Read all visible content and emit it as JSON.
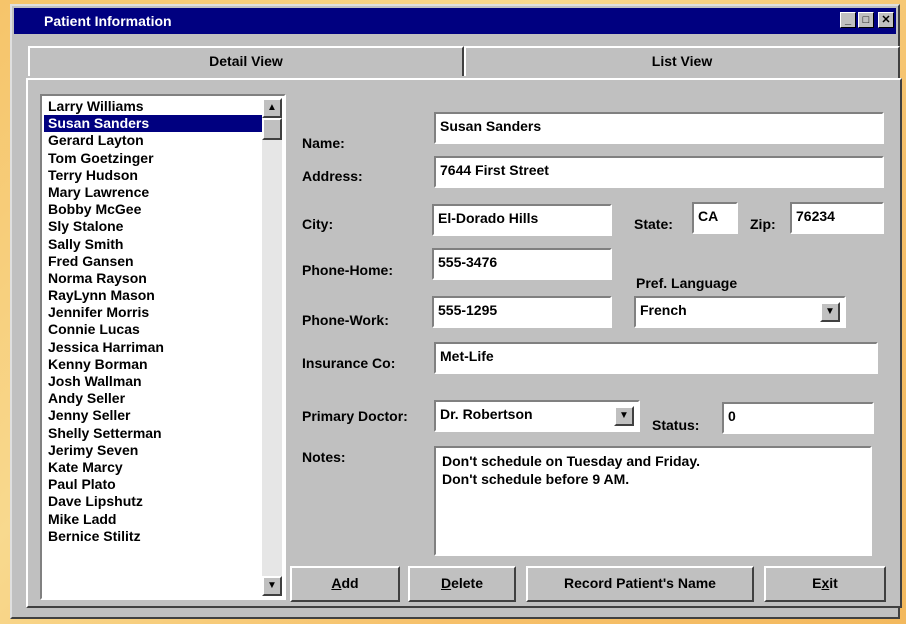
{
  "window": {
    "title": "Patient Information",
    "controls": {
      "minimize": "_",
      "maximize": "□",
      "close": "✕"
    }
  },
  "tabs": [
    {
      "label": "Detail View",
      "active": true
    },
    {
      "label": "List View",
      "active": false
    }
  ],
  "patients": [
    "Larry Williams",
    "Susan Sanders",
    "Gerard Layton",
    "Tom Goetzinger",
    "Terry Hudson",
    "Mary Lawrence",
    "Bobby McGee",
    "Sly Stalone",
    "Sally Smith",
    "Fred Gansen",
    "Norma Rayson",
    "RayLynn Mason",
    "Jennifer Morris",
    "Connie Lucas",
    "Jessica Harriman",
    "Kenny Borman",
    "Josh Wallman",
    "Andy Seller",
    "Jenny Seller",
    "Shelly Setterman",
    "Jerimy Seven",
    "Kate Marcy",
    "Paul Plato",
    "Dave Lipshutz",
    "Mike Ladd",
    "Bernice Stilitz"
  ],
  "selected_patient_index": 1,
  "form": {
    "name_label": "Name:",
    "name": "Susan Sanders",
    "address_label": "Address:",
    "address": "7644 First Street",
    "city_label": "City:",
    "city": "El-Dorado Hills",
    "state_label": "State:",
    "state": "CA",
    "zip_label": "Zip:",
    "zip": "76234",
    "phone_home_label": "Phone-Home:",
    "phone_home": "555-3476",
    "pref_language_label": "Pref. Language",
    "pref_language": "French",
    "phone_work_label": "Phone-Work:",
    "phone_work": "555-1295",
    "insurance_label": "Insurance Co:",
    "insurance": "Met-Life",
    "doctor_label": "Primary Doctor:",
    "doctor": "Dr. Robertson",
    "status_label": "Status:",
    "status": "0",
    "notes_label": "Notes:",
    "notes": [
      "Don't schedule on Tuesday and Friday.",
      "Don't schedule before 9 AM."
    ]
  },
  "buttons": {
    "add": {
      "pre": "",
      "key": "A",
      "post": "dd"
    },
    "delete": {
      "pre": "",
      "key": "D",
      "post": "elete"
    },
    "record": {
      "label": "Record Patient's Name"
    },
    "exit": {
      "pre": "E",
      "key": "x",
      "post": "it"
    }
  },
  "colors": {
    "titlebar": "#000080",
    "selection": "#000080",
    "face": "#c0c0c0"
  }
}
